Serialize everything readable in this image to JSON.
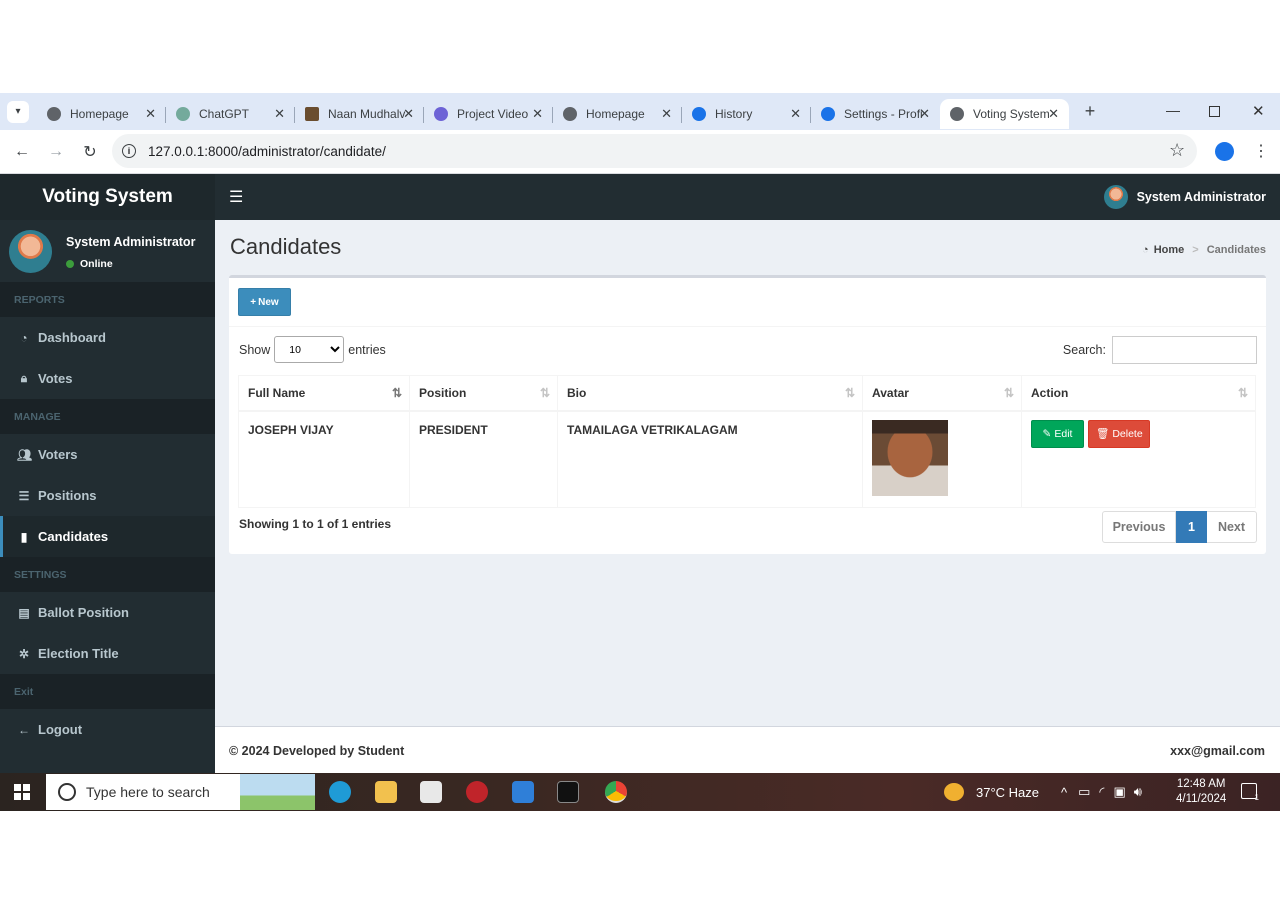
{
  "browser": {
    "tabs": [
      {
        "label": "Homepage",
        "icon": "globe-icon"
      },
      {
        "label": "ChatGPT",
        "icon": "chatgpt-icon"
      },
      {
        "label": "Naan Mudhalvan",
        "icon": "naan-mudhalvan-icon"
      },
      {
        "label": "Project Video",
        "icon": "project-video-icon"
      },
      {
        "label": "Homepage",
        "icon": "globe-icon"
      },
      {
        "label": "History",
        "icon": "history-icon"
      },
      {
        "label": "Settings - Profile",
        "icon": "settings-icon"
      },
      {
        "label": "Voting System",
        "icon": "globe-icon",
        "active": true
      }
    ],
    "url": "127.0.0.1:8000/administrator/candidate/"
  },
  "app": {
    "brand": "Voting System",
    "top_user": "System Administrator"
  },
  "sidebar": {
    "user_name": "System Administrator",
    "user_status": "Online",
    "sections": [
      {
        "header": "REPORTS",
        "items": [
          {
            "label": "Dashboard",
            "icon": "dashboard-icon"
          },
          {
            "label": "Votes",
            "icon": "lock-icon"
          }
        ]
      },
      {
        "header": "MANAGE",
        "items": [
          {
            "label": "Voters",
            "icon": "users-icon"
          },
          {
            "label": "Positions",
            "icon": "tasks-icon"
          },
          {
            "label": "Candidates",
            "icon": "black-tie-icon",
            "active": true
          }
        ]
      },
      {
        "header": "SETTINGS",
        "items": [
          {
            "label": "Ballot Position",
            "icon": "file-text-icon"
          },
          {
            "label": "Election Title",
            "icon": "cog-icon"
          }
        ]
      },
      {
        "header": "Exit",
        "items": [
          {
            "label": "Logout",
            "icon": "arrow-left-icon"
          }
        ]
      }
    ]
  },
  "page": {
    "title": "Candidates",
    "breadcrumb_home": "Home",
    "breadcrumb_current": "Candidates",
    "new_button": "New",
    "show_label": "Show",
    "entries_value": "10",
    "entries_label": "entries",
    "search_label": "Search:",
    "columns": [
      "Full Name",
      "Position",
      "Bio",
      "Avatar",
      "Action"
    ],
    "rows": [
      {
        "full_name": "JOSEPH VIJAY",
        "position": "PRESIDENT",
        "bio": "TAMAILAGA VETRIKALAGAM",
        "edit": "Edit",
        "delete": "Delete"
      }
    ],
    "info": "Showing 1 to 1 of 1 entries",
    "pager": {
      "previous": "Previous",
      "current": "1",
      "next": "Next"
    }
  },
  "footer": {
    "left": "© 2024 Developed by Student",
    "right": "xxx@gmail.com"
  },
  "taskbar": {
    "search_placeholder": "Type here to search",
    "weather": "37°C  Haze",
    "time": "12:48 AM",
    "date": "4/11/2024",
    "notification_count": "1"
  },
  "colors": {
    "sidebar": "#222d32",
    "primary": "#3c8dbc",
    "success": "#00a65a",
    "danger": "#dd4b39"
  }
}
